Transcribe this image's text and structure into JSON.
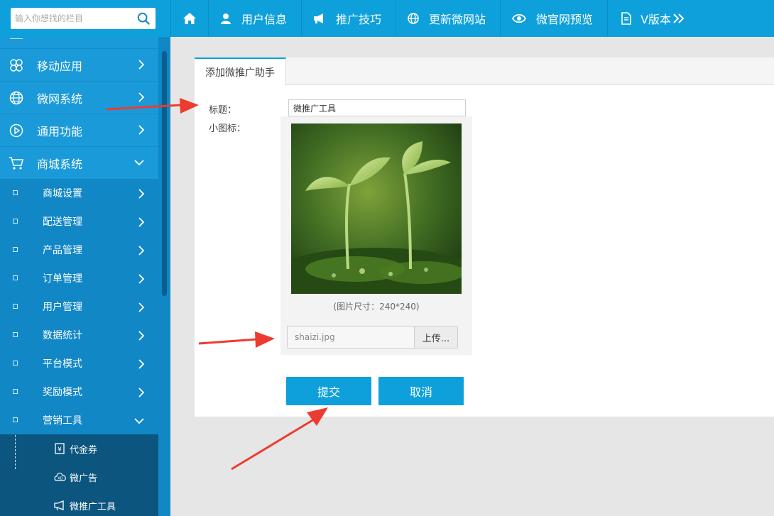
{
  "search": {
    "placeholder": "输入你想找的栏目"
  },
  "topnav": {
    "items": [
      {
        "label": "用户信息"
      },
      {
        "label": "推广技巧"
      },
      {
        "label": "更新微网站"
      },
      {
        "label": "微官网预览"
      },
      {
        "label": "V版本"
      }
    ]
  },
  "sidebar": {
    "main": [
      {
        "label": "移动应用"
      },
      {
        "label": "微网系统"
      },
      {
        "label": "通用功能"
      },
      {
        "label": "商城系统"
      }
    ],
    "sub": [
      {
        "label": "商城设置"
      },
      {
        "label": "配送管理"
      },
      {
        "label": "产品管理"
      },
      {
        "label": "订单管理"
      },
      {
        "label": "用户管理"
      },
      {
        "label": "数据统计"
      },
      {
        "label": "平台模式"
      },
      {
        "label": "奖励模式"
      },
      {
        "label": "营销工具"
      }
    ],
    "third": [
      {
        "label": "代金券"
      },
      {
        "label": "微广告"
      },
      {
        "label": "微推广工具"
      }
    ]
  },
  "panel": {
    "tab_label": "添加微推广助手",
    "title_label": "标题：",
    "title_value": "微推广工具",
    "icon_label": "小图标：",
    "image_hint": "(图片尺寸：240*240)",
    "file_name": "shaizi.jpg",
    "upload_label": "上传...",
    "submit_label": "提交",
    "cancel_label": "取消"
  },
  "colors": {
    "accent": "#0ea0da",
    "sidebar": "#1187c6",
    "sidebar_dark": "#0b557e",
    "arrow": "#ee3b30"
  }
}
